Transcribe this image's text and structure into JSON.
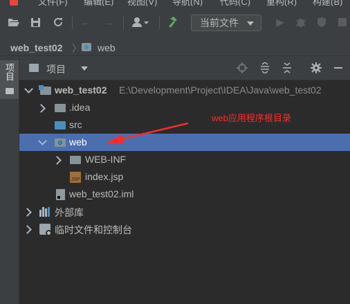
{
  "menubar": {
    "items": [
      "文件(F)",
      "编辑(E)",
      "视图(V)",
      "导航(N)",
      "代码(C)",
      "重构(R)",
      "构建(B)"
    ]
  },
  "toolbar": {
    "run_config_label": "当前文件"
  },
  "breadcrumb": {
    "project": "web_test02",
    "folder": "web"
  },
  "sidebar": {
    "tab_label": "项目"
  },
  "panel": {
    "title": "项目"
  },
  "tree": {
    "root": {
      "label": "web_test02",
      "path": "E:\\Development\\Project\\IDEA\\Java\\web_test02"
    },
    "idea": "​.idea",
    "src": "src",
    "web": "web",
    "webinf": "WEB-INF",
    "indexjsp": "index.jsp",
    "iml": "web_test02.iml",
    "external_libs": "外部库",
    "scratches": "临时文件和控制台",
    "jsp_badge": "JSP"
  },
  "annotation": {
    "text": "web应用程序根目录",
    "color": "#ff2b2b"
  },
  "colors": {
    "selection": "#4b6eaf",
    "background": "#2b2b2b",
    "toolbar": "#3c3f41",
    "build_icon": "#59a869"
  }
}
